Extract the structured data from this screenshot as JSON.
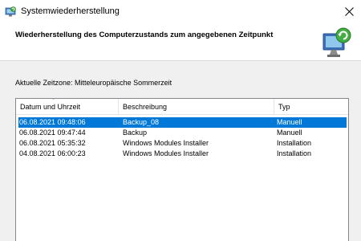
{
  "window": {
    "title": "Systemwiederherstellung",
    "icon": "system-restore-icon",
    "close_icon": "close-icon"
  },
  "header": {
    "heading": "Wiederherstellung des Computerzustands zum angegebenen Zeitpunkt",
    "art_icon": "system-restore-monitor-icon"
  },
  "timezone_label": "Aktuelle Zeitzone: Mitteleuropäische Sommerzeit",
  "table": {
    "columns": [
      "Datum und Uhrzeit",
      "Beschreibung",
      "Typ"
    ],
    "sort_indicator": "˅",
    "rows": [
      {
        "date": "06.08.2021 09:48:06",
        "description": "Backup_08",
        "type": "Manuell",
        "selected": true
      },
      {
        "date": "06.08.2021 09:47:44",
        "description": "Backup",
        "type": "Manuell",
        "selected": false
      },
      {
        "date": "06.08.2021 05:35:32",
        "description": "Windows Modules Installer",
        "type": "Installation",
        "selected": false
      },
      {
        "date": "04.08.2021 06:00:23",
        "description": "Windows Modules Installer",
        "type": "Installation",
        "selected": false
      }
    ]
  },
  "colors": {
    "selection": "#0078d7",
    "panel_background": "#f0f0f0"
  }
}
